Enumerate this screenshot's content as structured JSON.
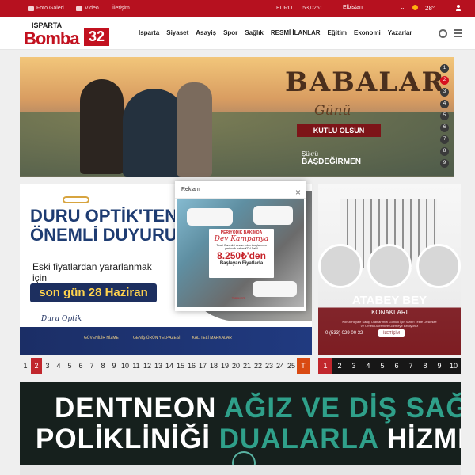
{
  "topbar": {
    "photo_gallery": "Foto Galeri",
    "video": "Video",
    "contact": "İletişim",
    "currency_label": "EURO",
    "currency_value": "53,0251",
    "city": "Elbistan",
    "temperature": "28°",
    "accent": "#b6111f"
  },
  "logo": {
    "top": "ISPARTA",
    "main": "Bomba",
    "num": "32"
  },
  "nav": [
    "Isparta",
    "Siyaset",
    "Asayiş",
    "Spor",
    "Sağlık",
    "RESMİ İLANLAR",
    "Eğitim",
    "Ekonomi",
    "Yazarlar"
  ],
  "hero": {
    "title": "BABALAR",
    "subtitle": "Günü",
    "ribbon": "KUTLU OLSUN",
    "sign_name": "BAŞDEĞİRMEN",
    "sign_top": "Şükrü",
    "pager": [
      "1",
      "2",
      "3",
      "4",
      "5",
      "6",
      "7",
      "8",
      "9"
    ]
  },
  "ad_left": {
    "title1": "DURU OPTİK'TEN",
    "title2": "ÖNEMLİ DUYURU:",
    "text": "Eski fiyatlardan yararlanmak için",
    "pill": "son gün 28 Haziran",
    "brand": "Duru Optik",
    "badges": [
      "GÜVENİLİR HİZMET",
      "GENİŞ ÜRÜN YELPAZESİ",
      "KALİTELİ MARKALAR"
    ],
    "pager": [
      "1",
      "2",
      "3",
      "4",
      "5",
      "6",
      "7",
      "8",
      "9",
      "10",
      "11",
      "12",
      "13",
      "14",
      "15",
      "16",
      "17",
      "18",
      "19",
      "20",
      "21",
      "22",
      "23",
      "24",
      "25",
      "T"
    ]
  },
  "ad_right": {
    "title": "ATABEY BEY",
    "subtitle": "KONAKLARI",
    "small_text": "Konut Hayale Sahip Olanlarımızı Gönlük İçin Sizleri Tekte Ofisimize ve Örnek Dairemize Görmeye Bekliyoruz",
    "phone": "0 (533) 029 00 32",
    "button": "İLETİŞİM",
    "pager": [
      "1",
      "2",
      "3",
      "4",
      "5",
      "6",
      "7",
      "8",
      "9",
      "10"
    ]
  },
  "banner": {
    "line1_a": "DENTNEON",
    "line1_b": "AĞIZ VE DİŞ SAĞLIĞI",
    "line2_a": "POLİKLİNİĞİ",
    "line2_b": "DUALARLA",
    "line2_c": "HİZMETE AÇILDI"
  },
  "modal": {
    "title": "Reklam",
    "close": "×",
    "card_a": "PERİYODİK BAKIMDA",
    "card_b": "Dev Kampanya",
    "card_c": "Ticari Garantisi devam eden Araçlarınıza periyodik bakım KDV Dahil",
    "card_d": "8.250₺'den",
    "card_e": "Başlayan Fiyatlarla",
    "logo": "TÜRKER"
  }
}
